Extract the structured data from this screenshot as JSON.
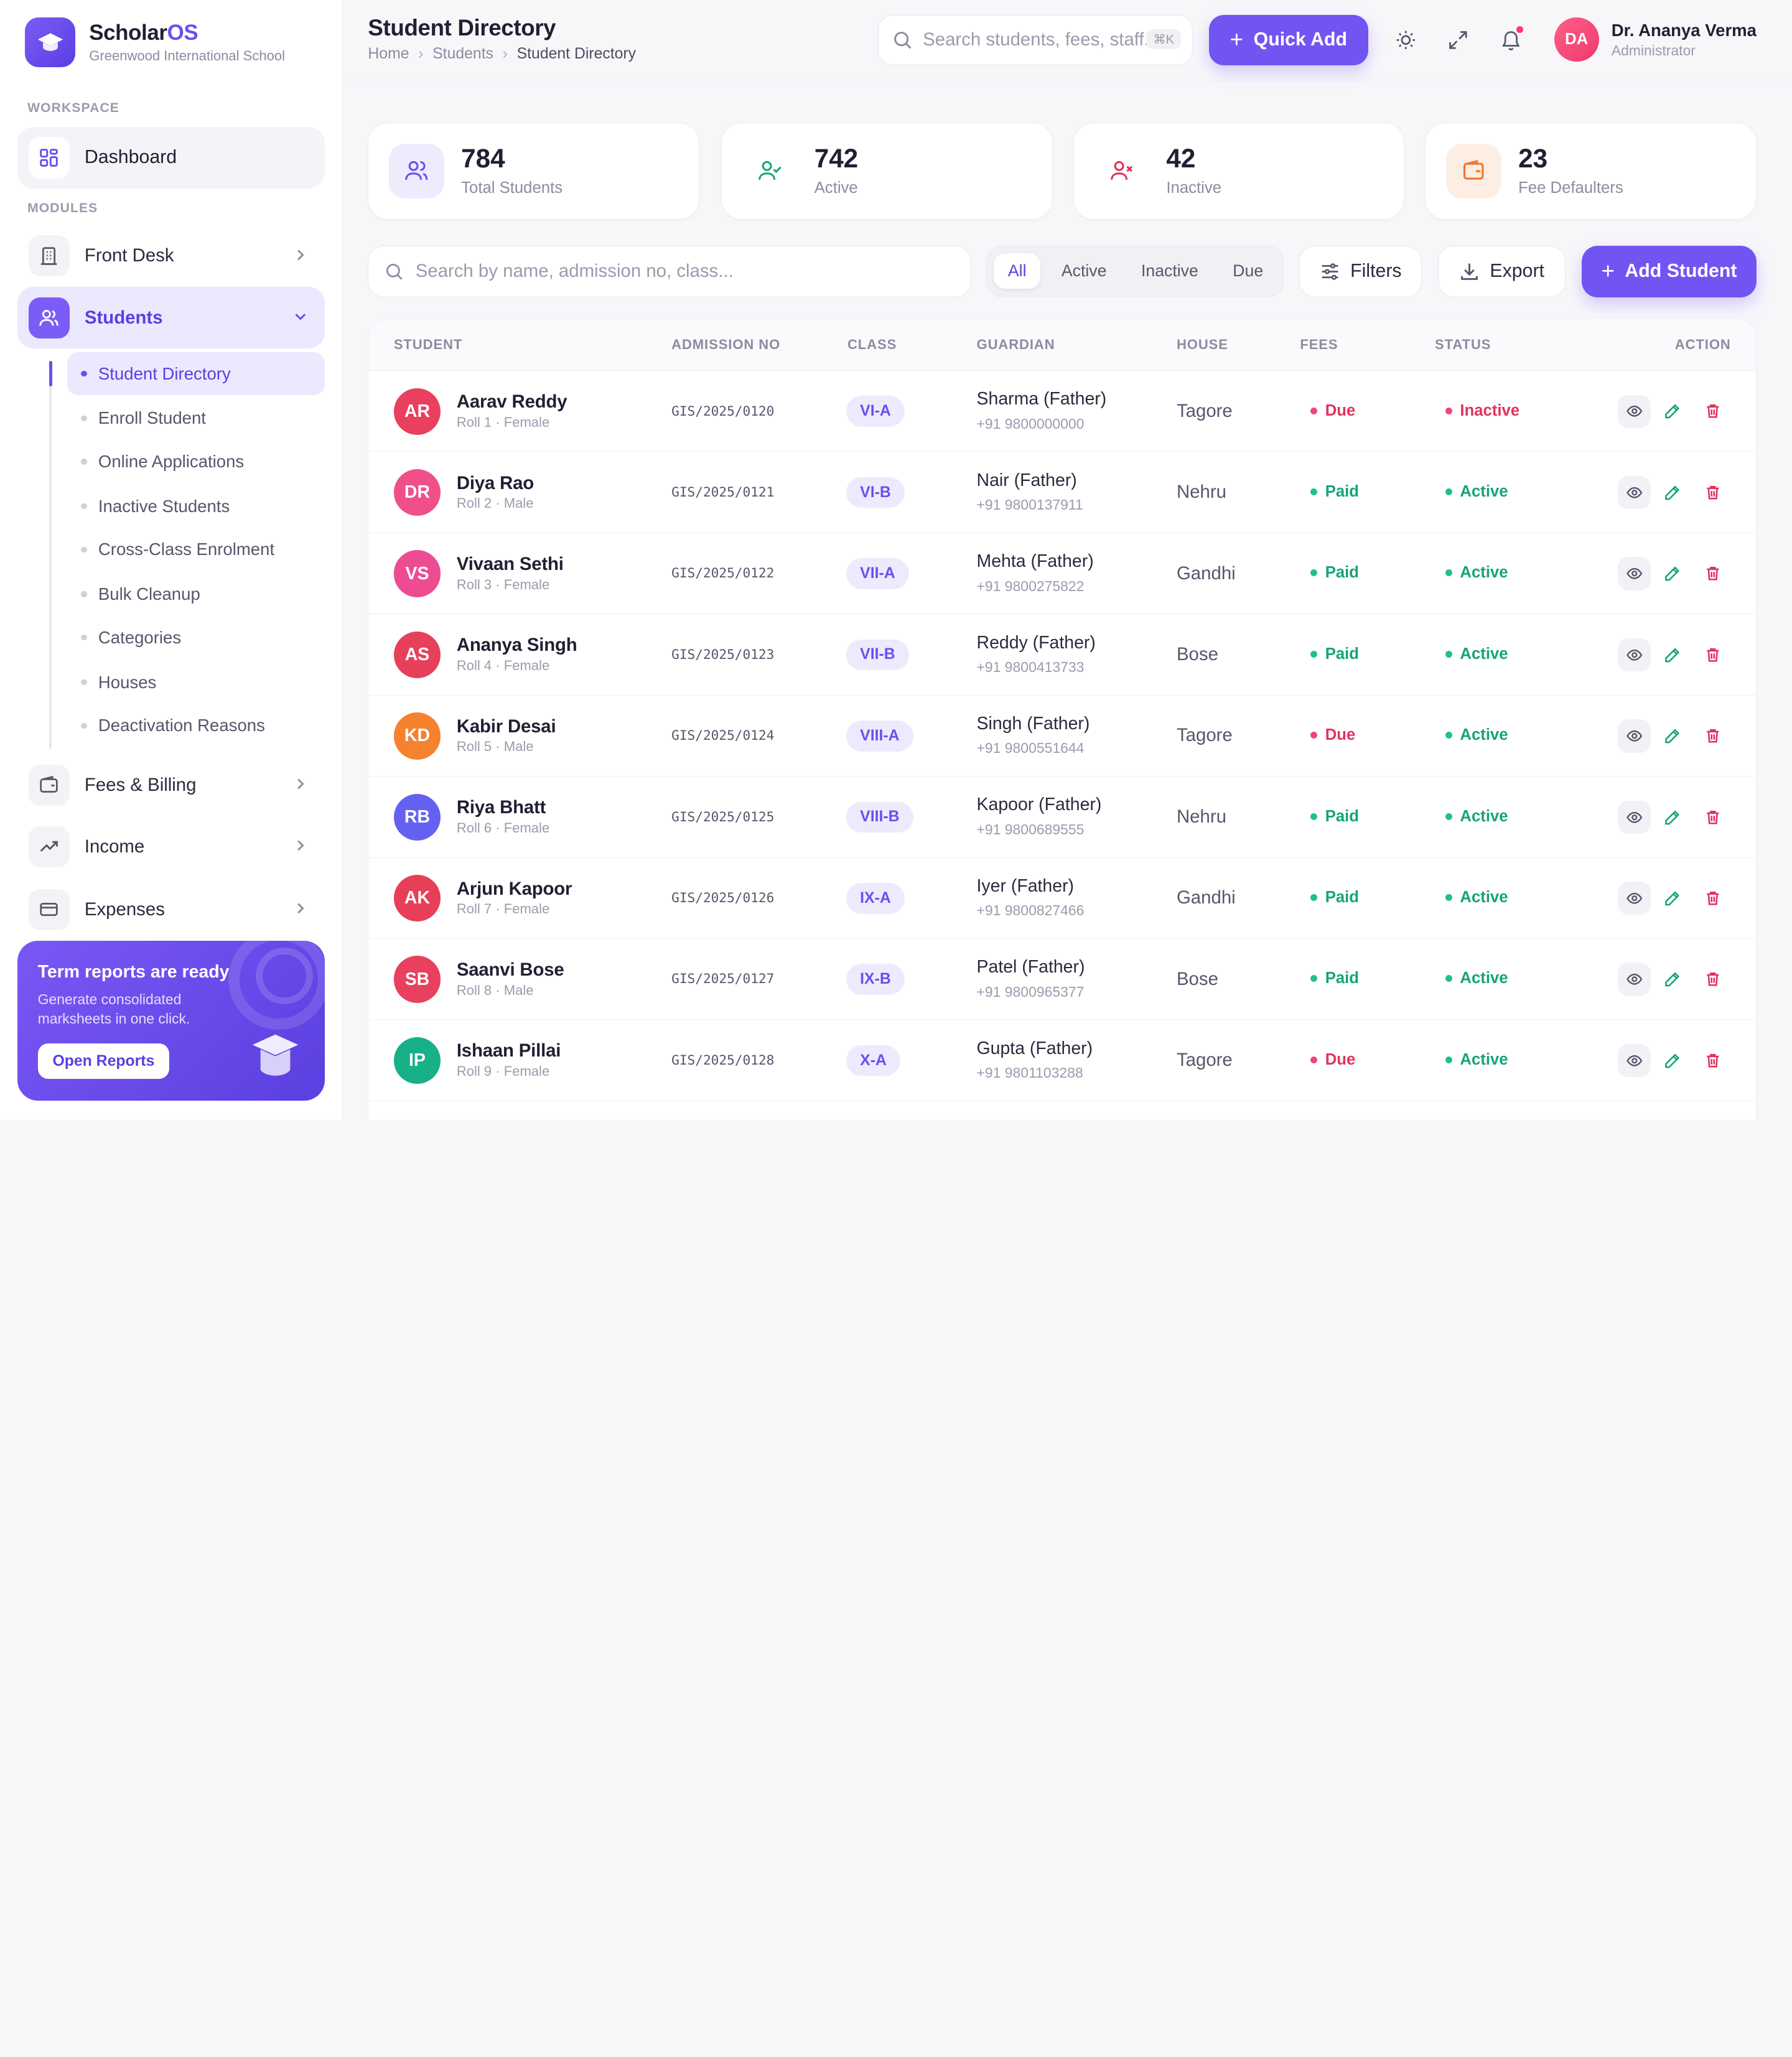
{
  "brand": {
    "name_main": "Scholar",
    "name_accent": "OS",
    "school": "Greenwood International School"
  },
  "sidebar": {
    "workspace_label": "WORKSPACE",
    "modules_label": "MODULES",
    "dashboard": "Dashboard",
    "front_desk": "Front Desk",
    "students": "Students",
    "sub_items": [
      "Student Directory",
      "Enroll Student",
      "Online Applications",
      "Inactive Students",
      "Cross-Class Enrolment",
      "Bulk Cleanup",
      "Categories",
      "Houses",
      "Deactivation Reasons"
    ],
    "fees": "Fees & Billing",
    "income": "Income",
    "expenses": "Expenses",
    "promo": {
      "title": "Term reports are ready",
      "desc": "Generate consolidated marksheets in one click.",
      "button": "Open Reports"
    }
  },
  "header": {
    "title": "Student Directory",
    "breadcrumb": [
      "Home",
      "Students",
      "Student Directory"
    ],
    "search_placeholder": "Search students, fees, staff...",
    "kbd": "⌘K",
    "quick_add": "Quick Add",
    "user": {
      "initials": "DA",
      "name": "Dr. Ananya Verma",
      "role": "Administrator"
    }
  },
  "stats": [
    {
      "value": "784",
      "label": "Total Students"
    },
    {
      "value": "742",
      "label": "Active"
    },
    {
      "value": "42",
      "label": "Inactive"
    },
    {
      "value": "23",
      "label": "Fee Defaulters"
    }
  ],
  "filters": {
    "search_placeholder": "Search by name, admission no, class...",
    "segments": [
      "All",
      "Active",
      "Inactive",
      "Due"
    ],
    "filters_btn": "Filters",
    "export_btn": "Export",
    "add_btn": "Add Student"
  },
  "table": {
    "headers": [
      "STUDENT",
      "ADMISSION NO",
      "CLASS",
      "GUARDIAN",
      "HOUSE",
      "FEES",
      "STATUS",
      "ACTION"
    ],
    "rows": [
      {
        "initials": "AR",
        "name": "Aarav Reddy",
        "meta": "Roll 1 · Female",
        "adm": "GIS/2025/0120",
        "cls": "VI-A",
        "guardian": "Sharma (Father)",
        "phone": "+91 9800000000",
        "house": "Tagore",
        "fee": "Due",
        "status": "Inactive",
        "color": "#e8405e"
      },
      {
        "initials": "DR",
        "name": "Diya Rao",
        "meta": "Roll 2 · Male",
        "adm": "GIS/2025/0121",
        "cls": "VI-B",
        "guardian": "Nair (Father)",
        "phone": "+91 9800137911",
        "house": "Nehru",
        "fee": "Paid",
        "status": "Active",
        "color": "#f0508a"
      },
      {
        "initials": "VS",
        "name": "Vivaan Sethi",
        "meta": "Roll 3 · Female",
        "adm": "GIS/2025/0122",
        "cls": "VII-A",
        "guardian": "Mehta (Father)",
        "phone": "+91 9800275822",
        "house": "Gandhi",
        "fee": "Paid",
        "status": "Active",
        "color": "#ee4c92"
      },
      {
        "initials": "AS",
        "name": "Ananya Singh",
        "meta": "Roll 4 · Female",
        "adm": "GIS/2025/0123",
        "cls": "VII-B",
        "guardian": "Reddy (Father)",
        "phone": "+91 9800413733",
        "house": "Bose",
        "fee": "Paid",
        "status": "Active",
        "color": "#e6405a"
      },
      {
        "initials": "KD",
        "name": "Kabir Desai",
        "meta": "Roll 5 · Male",
        "adm": "GIS/2025/0124",
        "cls": "VIII-A",
        "guardian": "Singh (Father)",
        "phone": "+91 9800551644",
        "house": "Tagore",
        "fee": "Due",
        "status": "Active",
        "color": "#f5822f"
      },
      {
        "initials": "RB",
        "name": "Riya Bhatt",
        "meta": "Roll 6 · Female",
        "adm": "GIS/2025/0125",
        "cls": "VIII-B",
        "guardian": "Kapoor (Father)",
        "phone": "+91 9800689555",
        "house": "Nehru",
        "fee": "Paid",
        "status": "Active",
        "color": "#6461f2"
      },
      {
        "initials": "AK",
        "name": "Arjun Kapoor",
        "meta": "Roll 7 · Female",
        "adm": "GIS/2025/0126",
        "cls": "IX-A",
        "guardian": "Iyer (Father)",
        "phone": "+91 9800827466",
        "house": "Gandhi",
        "fee": "Paid",
        "status": "Active",
        "color": "#e63f57"
      },
      {
        "initials": "SB",
        "name": "Saanvi Bose",
        "meta": "Roll 8 · Male",
        "adm": "GIS/2025/0127",
        "cls": "IX-B",
        "guardian": "Patel (Father)",
        "phone": "+91 9800965377",
        "house": "Bose",
        "fee": "Paid",
        "status": "Active",
        "color": "#e8405e"
      },
      {
        "initials": "IP",
        "name": "Ishaan Pillai",
        "meta": "Roll 9 · Female",
        "adm": "GIS/2025/0128",
        "cls": "X-A",
        "guardian": "Gupta (Father)",
        "phone": "+91 9801103288",
        "house": "Tagore",
        "fee": "Due",
        "status": "Active",
        "color": "#18b088"
      }
    ]
  },
  "colors": {
    "accent": "#7254f3",
    "paid": "#16a37b",
    "due": "#e0325f"
  }
}
